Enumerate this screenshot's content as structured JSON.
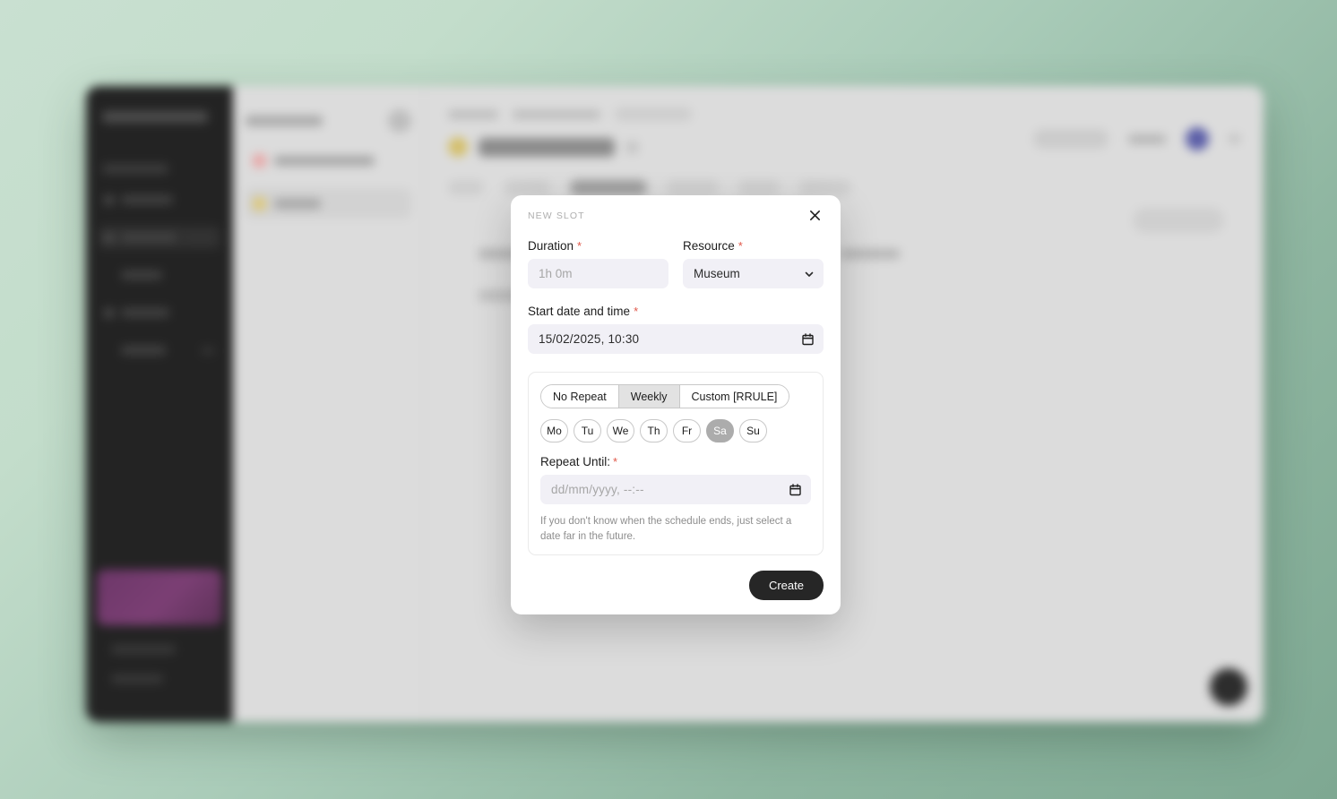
{
  "modal": {
    "eyebrow": "NEW SLOT",
    "close_icon": "close-icon",
    "duration": {
      "label": "Duration",
      "required_mark": "*",
      "value": "",
      "placeholder": "1h 0m"
    },
    "resource": {
      "label": "Resource",
      "required_mark": "*",
      "selected": "Museum",
      "options": [
        "Museum"
      ],
      "chevron_icon": "chevron-down-icon"
    },
    "start": {
      "label": "Start date and time",
      "required_mark": "*",
      "value": "15/02/2025, 10:30",
      "calendar_icon": "calendar-icon"
    },
    "recurrence": {
      "segments": [
        {
          "label": "No Repeat",
          "active": false
        },
        {
          "label": "Weekly",
          "active": true
        },
        {
          "label": "Custom [RRULE]",
          "active": false
        }
      ],
      "days": [
        {
          "label": "Mo",
          "selected": false
        },
        {
          "label": "Tu",
          "selected": false
        },
        {
          "label": "We",
          "selected": false
        },
        {
          "label": "Th",
          "selected": false
        },
        {
          "label": "Fr",
          "selected": false
        },
        {
          "label": "Sa",
          "selected": true
        },
        {
          "label": "Su",
          "selected": false
        }
      ],
      "repeat_until_label": "Repeat Until:",
      "repeat_until_required": "*",
      "repeat_until_value": "",
      "repeat_until_placeholder": "dd/mm/yyyy, --:--",
      "hint": "If you don't know when the schedule ends, just select a date far in the future."
    },
    "create_label": "Create"
  },
  "colors": {
    "page_background_light": "#c9e0d1",
    "page_background_dark": "#7ea892",
    "sidebar": "#232323",
    "promo_card": "#7b3f74",
    "accent_required": "#e0584a",
    "primary_button": "#262626",
    "input_background": "#f1f0f6",
    "day_selected": "#acacac",
    "avatar": "#5c5fa8"
  }
}
